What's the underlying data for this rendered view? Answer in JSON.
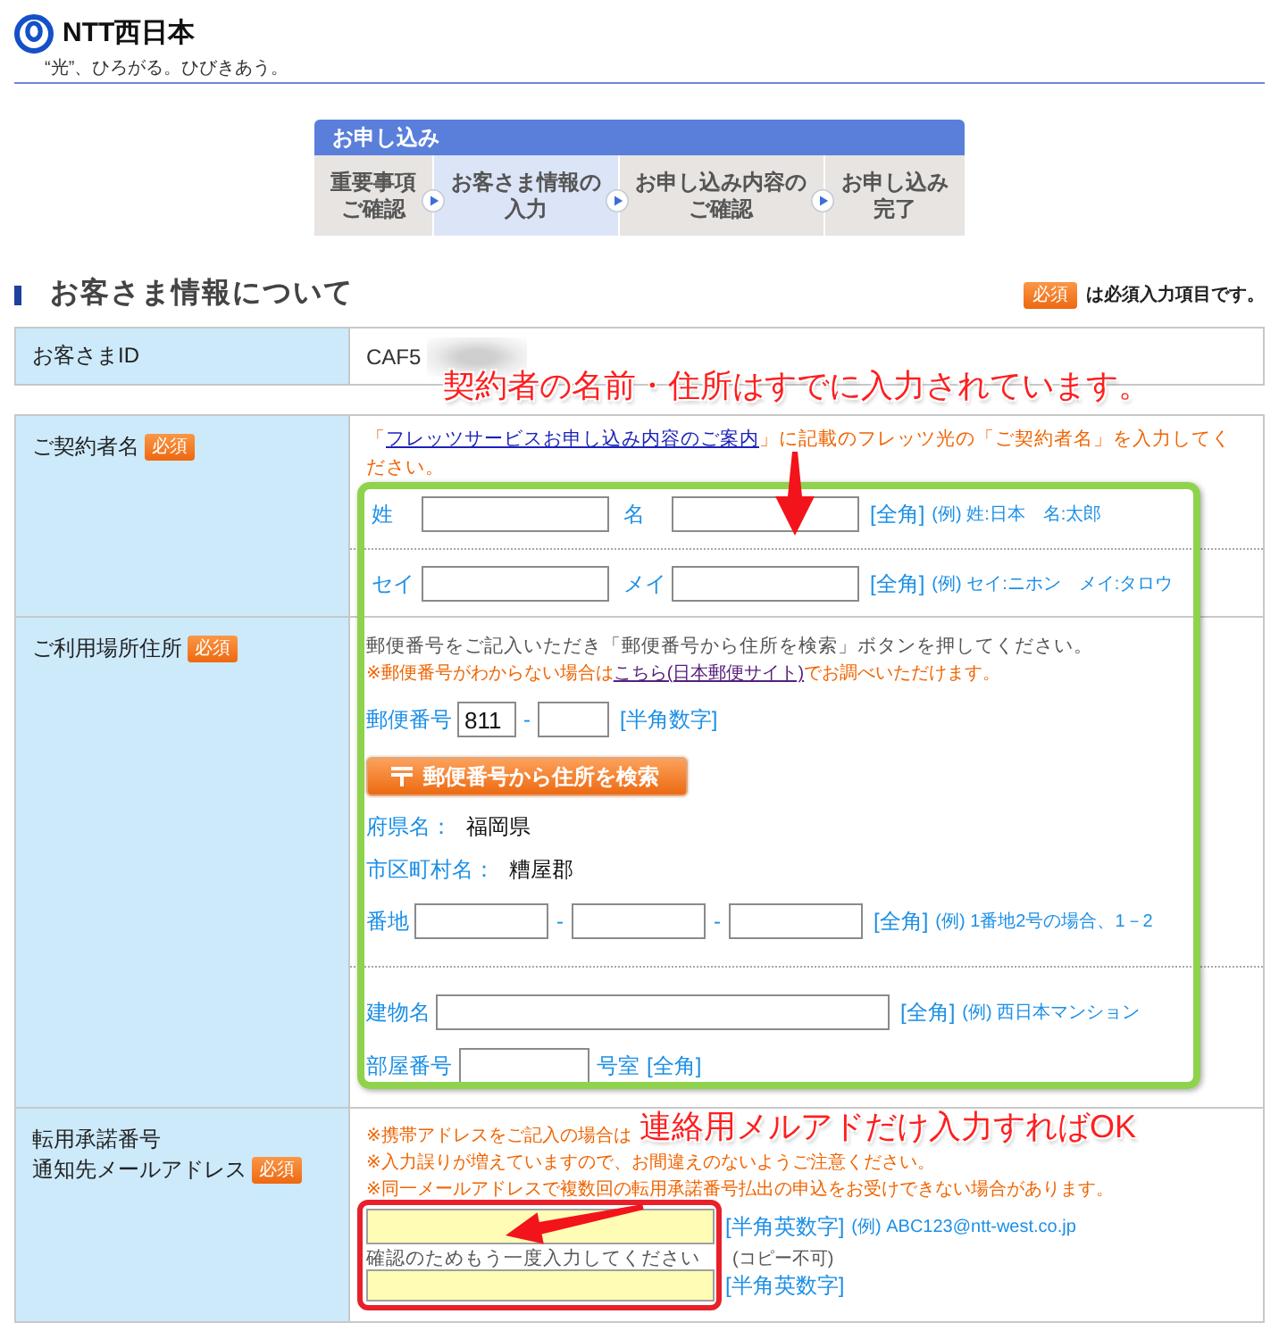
{
  "header": {
    "brand": "NTT西日本",
    "tagline": "“光”、ひろがる。ひびきあう。"
  },
  "steps": {
    "title": "お申し込み",
    "items": [
      {
        "lines": [
          "重要事項",
          "ご確認"
        ],
        "selected": false
      },
      {
        "lines": [
          "お客さま情報の",
          "入力"
        ],
        "selected": true
      },
      {
        "lines": [
          "お申し込み内容の",
          "ご確認"
        ],
        "selected": false
      },
      {
        "lines": [
          "お申し込み",
          "完了"
        ],
        "selected": false
      }
    ]
  },
  "section": {
    "title": "お客さま情報について",
    "badge": "必須",
    "legend": "は必須入力項目です。"
  },
  "customer_id": {
    "label": "お客さまID",
    "value": "CAF5"
  },
  "contract": {
    "label": "ご契約者名",
    "badge": "必須",
    "instruction": {
      "before": "「",
      "link": "フレッツサービスお申し込み内容のご案内",
      "after": "」に記載のフレッツ光の「ご契約者名」を入力してください。"
    },
    "name_rows": [
      {
        "fields": [
          {
            "label": "姓"
          },
          {
            "label": "名"
          }
        ],
        "format": "[全角]",
        "example": "(例) 姓:日本　名:太郎"
      },
      {
        "fields": [
          {
            "label": "セイ"
          },
          {
            "label": "メイ"
          }
        ],
        "format": "[全角]",
        "example": "(例) セイ:ニホン　メイ:タロウ"
      }
    ]
  },
  "address": {
    "label": "ご利用場所住所",
    "badge": "必須",
    "instruction": "郵便番号をご記入いただき「郵便番号から住所を検索」ボタンを押してください。",
    "lookup": {
      "before": "※郵便番号がわからない場合は",
      "link": "こちら(日本郵便サイト)",
      "after": "でお調べいただけます。"
    },
    "postal": {
      "label": "郵便番号",
      "value": "811",
      "separator": "-",
      "format": "[半角数字]"
    },
    "search_button": "郵便番号から住所を検索",
    "prefecture": {
      "label": "府県名：",
      "value": "福岡県"
    },
    "city": {
      "label": "市区町村名：",
      "value": "糟屋郡"
    },
    "street": {
      "label": "番地",
      "separators": [
        "-",
        "-"
      ],
      "format": "[全角]",
      "example": "(例) 1番地2号の場合、1－2"
    },
    "building": {
      "label": "建物名",
      "format": "[全角]",
      "example": "(例) 西日本マンション"
    },
    "room": {
      "label": "部屋番号",
      "suffix": "号室",
      "format": "[全角]"
    }
  },
  "email": {
    "label_lines": [
      "転用承諾番号",
      "通知先メールアドレス"
    ],
    "badge": "必須",
    "notes": [
      "※携帯アドレスをご記入の場合は",
      "※入力誤りが増えていますので、お間違えのないようご注意ください。",
      "※同一メールアドレスで複数回の転用承諾番号払出の申込をお受けできない場合があります。"
    ],
    "format": "[半角英数字]",
    "example": "(例) ABC123@ntt-west.co.jp",
    "confirm_label": "確認のためもう一度入力してください",
    "confirm_note": "(コピー不可)",
    "confirm_format": "[半角英数字]"
  },
  "annotations": [
    {
      "text": "契約者の名前・住所はすでに入力されています。"
    },
    {
      "text": "連絡用メルアドだけ入力すればOK"
    }
  ]
}
